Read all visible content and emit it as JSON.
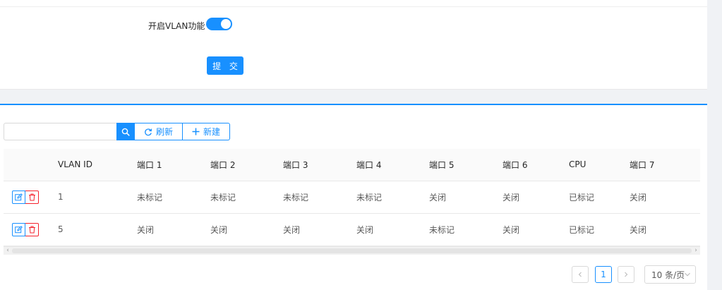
{
  "settings": {
    "vlan_label": "开启VLAN功能",
    "vlan_enabled": true,
    "submit_label": "提 交"
  },
  "toolbar": {
    "search_value": "",
    "refresh_label": "刷新",
    "new_label": "新建",
    "search_icon": "search-icon",
    "refresh_icon": "refresh-icon",
    "new_icon": "plus-icon"
  },
  "table": {
    "columns": [
      "",
      "VLAN ID",
      "端口 1",
      "端口 2",
      "端口 3",
      "端口 4",
      "端口 5",
      "端口 6",
      "CPU",
      "端口 7"
    ],
    "rows": [
      {
        "vlan_id": "1",
        "port1": "未标记",
        "port2": "未标记",
        "port3": "未标记",
        "port4": "未标记",
        "port5": "关闭",
        "port6": "关闭",
        "cpu": "已标记",
        "port7": "关闭"
      },
      {
        "vlan_id": "5",
        "port1": "关闭",
        "port2": "关闭",
        "port3": "关闭",
        "port4": "关闭",
        "port5": "未标记",
        "port6": "关闭",
        "cpu": "已标记",
        "port7": "关闭"
      }
    ]
  },
  "pagination": {
    "current_page": "1",
    "page_size_label": "10 条/页"
  },
  "colors": {
    "primary": "#1890ff",
    "danger": "#f5222d"
  }
}
